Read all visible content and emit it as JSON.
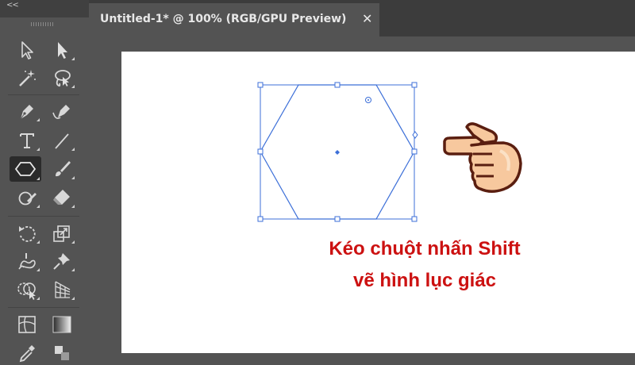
{
  "toolbar": {
    "collapse_glyph": "<<",
    "tools": [
      {
        "name": "selection-tool",
        "icon": "arrow-outline-icon"
      },
      {
        "name": "direct-selection-tool",
        "icon": "arrow-filled-icon"
      },
      {
        "name": "magic-wand-tool",
        "icon": "magic-wand-icon"
      },
      {
        "name": "lasso-tool",
        "icon": "lasso-icon"
      },
      {
        "name": "pen-tool",
        "icon": "pen-icon"
      },
      {
        "name": "curvature-tool",
        "icon": "curvature-pen-icon"
      },
      {
        "name": "type-tool",
        "icon": "type-t-icon"
      },
      {
        "name": "line-segment-tool",
        "icon": "line-icon"
      },
      {
        "name": "polygon-tool",
        "icon": "hexagon-icon",
        "active": true
      },
      {
        "name": "paintbrush-tool",
        "icon": "brush-icon"
      },
      {
        "name": "shaper-tool",
        "icon": "shaper-icon"
      },
      {
        "name": "eraser-tool",
        "icon": "eraser-icon"
      },
      {
        "name": "rotate-tool",
        "icon": "rotate-icon"
      },
      {
        "name": "scale-tool",
        "icon": "scale-icon"
      },
      {
        "name": "warp-tool",
        "icon": "warp-icon"
      },
      {
        "name": "puppet-warp-tool",
        "icon": "pin-icon"
      },
      {
        "name": "shape-builder-tool",
        "icon": "shape-builder-icon"
      },
      {
        "name": "perspective-grid-tool",
        "icon": "perspective-grid-icon"
      },
      {
        "name": "mesh-tool",
        "icon": "mesh-icon"
      },
      {
        "name": "gradient-tool",
        "icon": "gradient-icon"
      }
    ]
  },
  "document_tab": {
    "title": "Untitled-1* @ 100% (RGB/GPU Preview)",
    "close_glyph": "✕"
  },
  "canvas": {
    "shape": "hexagon",
    "selection_color": "#3c6fd8"
  },
  "caption": {
    "line1": "Kéo chuột nhấn Shift",
    "line2": "vẽ hình lục giác",
    "color": "#cc1111"
  },
  "pointer_hand": {
    "icon": "pointing-hand-icon"
  }
}
